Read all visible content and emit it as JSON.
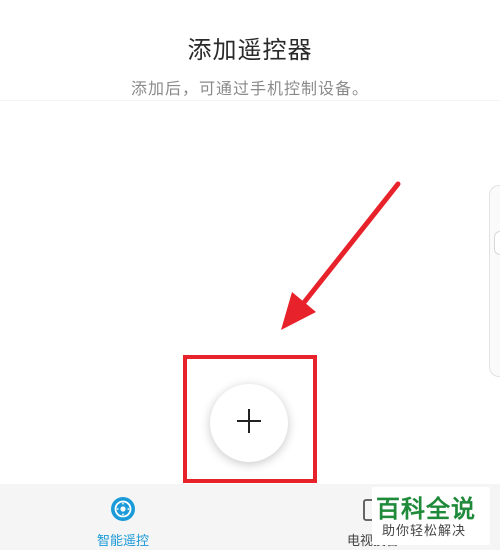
{
  "header": {
    "title": "添加遥控器",
    "subtitle": "添加后，可通过手机控制设备。"
  },
  "add_button": {
    "icon": "plus-icon"
  },
  "annotation": {
    "arrow_color": "#e8222a",
    "box_color": "#e8222a"
  },
  "tabbar": {
    "tabs": [
      {
        "label": "智能遥控",
        "icon": "remote-control-icon",
        "active": true
      },
      {
        "label": "电视投台",
        "icon": "tv-icon",
        "active": false
      }
    ]
  },
  "watermark": {
    "title": "百科全说",
    "subtitle": "助你轻松解决"
  },
  "colors": {
    "accent": "#1a9ad8",
    "annotation_red": "#e8222a",
    "watermark_green": "#1f8a3a"
  }
}
